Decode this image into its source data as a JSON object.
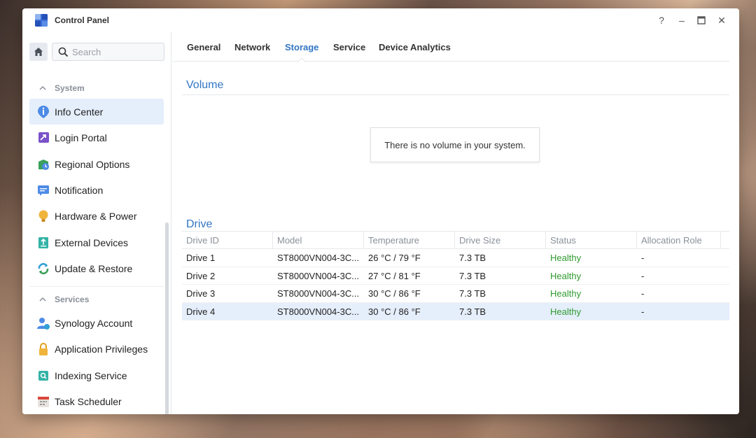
{
  "window": {
    "title": "Control Panel"
  },
  "titlebar_controls": [
    "?",
    "–",
    "□",
    "✕"
  ],
  "sidebar": {
    "search_placeholder": "Search",
    "sections": [
      {
        "label": "System"
      },
      {
        "label": "Services"
      }
    ],
    "system_items": [
      {
        "label": "Info Center",
        "icon": "info-icon",
        "active": true
      },
      {
        "label": "Login Portal",
        "icon": "login-portal-icon"
      },
      {
        "label": "Regional Options",
        "icon": "regional-options-icon"
      },
      {
        "label": "Notification",
        "icon": "notification-icon"
      },
      {
        "label": "Hardware & Power",
        "icon": "lightbulb-icon"
      },
      {
        "label": "External Devices",
        "icon": "external-device-icon"
      },
      {
        "label": "Update & Restore",
        "icon": "update-icon"
      }
    ],
    "services_items": [
      {
        "label": "Synology Account",
        "icon": "account-icon"
      },
      {
        "label": "Application Privileges",
        "icon": "lock-icon"
      },
      {
        "label": "Indexing Service",
        "icon": "indexing-icon"
      },
      {
        "label": "Task Scheduler",
        "icon": "calendar-icon"
      }
    ]
  },
  "tabs": [
    {
      "label": "General"
    },
    {
      "label": "Network"
    },
    {
      "label": "Storage",
      "active": true
    },
    {
      "label": "Service"
    },
    {
      "label": "Device Analytics"
    }
  ],
  "volume": {
    "title": "Volume",
    "empty_message": "There is no volume in your system."
  },
  "drive": {
    "title": "Drive",
    "columns": [
      "Drive ID",
      "Model",
      "Temperature",
      "Drive Size",
      "Status",
      "Allocation Role"
    ],
    "rows": [
      {
        "id": "Drive 1",
        "model": "ST8000VN004-3C...",
        "temperature": "26 °C / 79 °F",
        "size": "7.3 TB",
        "status": "Healthy",
        "role": "-"
      },
      {
        "id": "Drive 2",
        "model": "ST8000VN004-3C...",
        "temperature": "27 °C / 81 °F",
        "size": "7.3 TB",
        "status": "Healthy",
        "role": "-"
      },
      {
        "id": "Drive 3",
        "model": "ST8000VN004-3C...",
        "temperature": "30 °C / 86 °F",
        "size": "7.3 TB",
        "status": "Healthy",
        "role": "-"
      },
      {
        "id": "Drive 4",
        "model": "ST8000VN004-3C...",
        "temperature": "30 °C / 86 °F",
        "size": "7.3 TB",
        "status": "Healthy",
        "role": "-",
        "selected": true
      }
    ]
  },
  "colors": {
    "accent": "#3175c4",
    "healthy": "#2f9a2f",
    "selected_bg": "#e5eefb"
  }
}
